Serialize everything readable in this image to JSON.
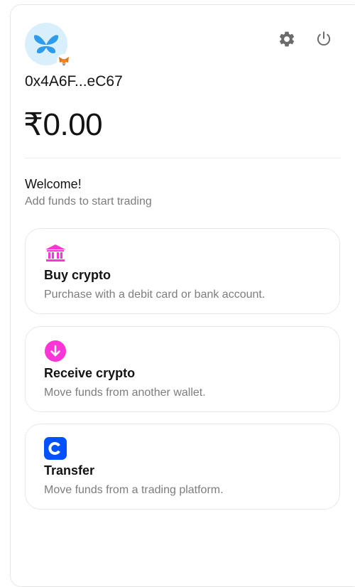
{
  "wallet": {
    "address": "0x4A6F...eC67",
    "balance": "₹0.00"
  },
  "header": {
    "settings_icon": "gear-icon",
    "power_icon": "power-icon"
  },
  "welcome": {
    "title": "Welcome!",
    "subtitle": "Add funds to start trading"
  },
  "actions": [
    {
      "title": "Buy crypto",
      "description": "Purchase with a debit card or bank account.",
      "icon": "bank-icon",
      "color": "#fc36d6"
    },
    {
      "title": "Receive crypto",
      "description": "Move funds from another wallet.",
      "icon": "arrow-down-circle-icon",
      "color": "#fc36d6"
    },
    {
      "title": "Transfer",
      "description": "Move funds from a trading platform.",
      "icon": "coinbase-icon",
      "color": "#0052ff"
    }
  ],
  "colors": {
    "accent": "#fc36d6",
    "avatar_bg": "#d9effc",
    "avatar_fg": "#2f9ceb",
    "muted_text": "#7d7d7d"
  }
}
